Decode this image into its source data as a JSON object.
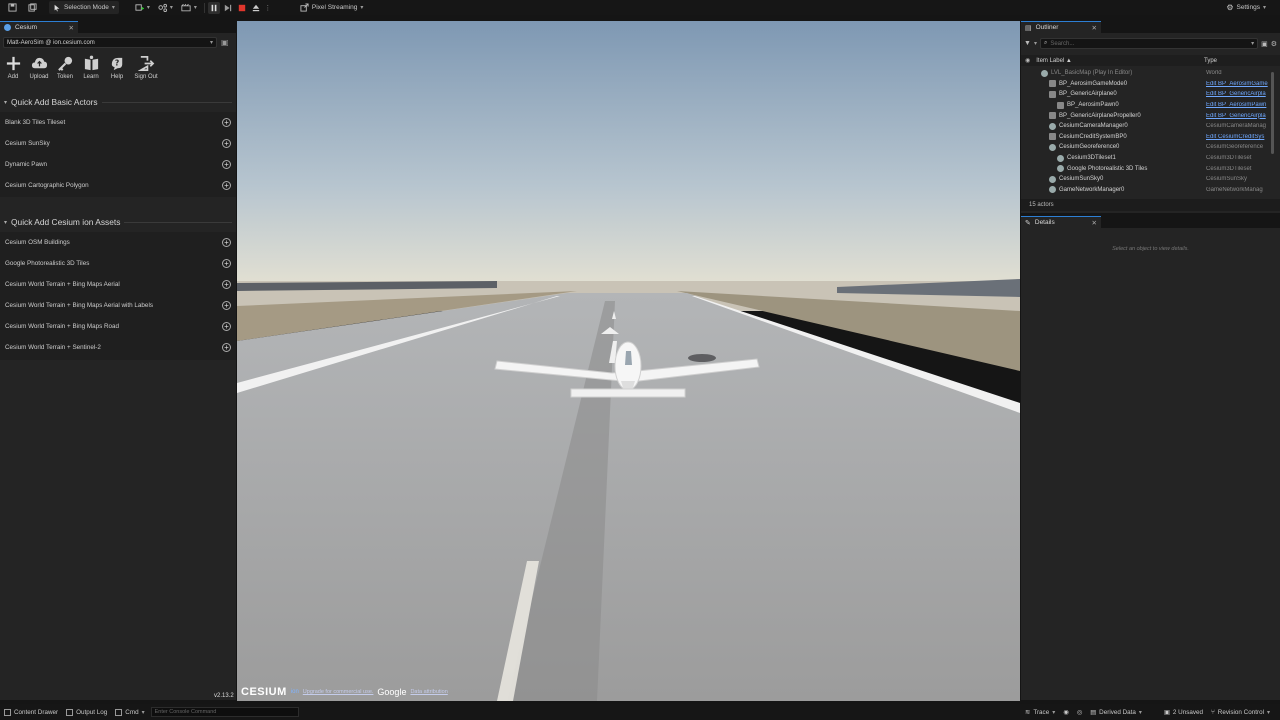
{
  "toolbar": {
    "mode_label": "Selection Mode",
    "streaming_label": "Pixel Streaming",
    "settings_label": "Settings"
  },
  "cesium_panel": {
    "tab_label": "Cesium",
    "account": "Matt-AeroSim @ ion.cesium.com",
    "tools": [
      {
        "label": "Add",
        "icon": "plus-icon"
      },
      {
        "label": "Upload",
        "icon": "cloud-upload-icon"
      },
      {
        "label": "Token",
        "icon": "key-icon"
      },
      {
        "label": "Learn",
        "icon": "book-icon"
      },
      {
        "label": "Help",
        "icon": "help-icon"
      },
      {
        "label": "Sign Out",
        "icon": "sign-out-icon"
      }
    ],
    "basic_header": "Quick Add Basic Actors",
    "basic_actors": [
      "Blank 3D Tiles Tileset",
      "Cesium SunSky",
      "Dynamic Pawn",
      "Cesium Cartographic Polygon"
    ],
    "ion_header": "Quick Add Cesium ion Assets",
    "ion_assets": [
      "Cesium OSM Buildings",
      "Google Photorealistic 3D Tiles",
      "Cesium World Terrain + Bing Maps Aerial",
      "Cesium World Terrain + Bing Maps Aerial with Labels",
      "Cesium World Terrain + Bing Maps Road",
      "Cesium World Terrain + Sentinel-2"
    ],
    "version": "v2.13.2"
  },
  "viewport": {
    "cesium_logo": "CESIUM",
    "ion_word": "ion",
    "upgrade_link": "Upgrade for commercial use.",
    "google_word": "Google",
    "data_attribution": "Data attribution"
  },
  "outliner": {
    "tab_label": "Outliner",
    "search_placeholder": "Search...",
    "col_label": "Item Label ▲",
    "col_type": "Type",
    "rows": [
      {
        "label": "LVL_BasicMap (Play In Editor)",
        "type": "World",
        "indent": 0,
        "dim": true,
        "link": false
      },
      {
        "label": "BP_AerosimGameMode0",
        "type": "Edit BP_AerosimGame",
        "indent": 1,
        "link": true
      },
      {
        "label": "BP_GenericAirplane0",
        "type": "Edit BP_GenericAirpla",
        "indent": 1,
        "link": true
      },
      {
        "label": "BP_AerosimPawn0",
        "type": "Edit BP_AerosimPawn",
        "indent": 2,
        "link": true
      },
      {
        "label": "BP_GenericAirplanePropeller0",
        "type": "Edit BP_GenericAirpla",
        "indent": 1,
        "link": true
      },
      {
        "label": "CesiumCameraManager0",
        "type": "CesiumCameraManag",
        "indent": 1,
        "link": false
      },
      {
        "label": "CesiumCreditSystemBP0",
        "type": "Edit CesiumCreditSys",
        "indent": 1,
        "link": true
      },
      {
        "label": "CesiumGeoreference0",
        "type": "CesiumGeoreference",
        "indent": 1,
        "link": false
      },
      {
        "label": "Cesium3DTileset1",
        "type": "Cesium3DTileset",
        "indent": 2,
        "link": false
      },
      {
        "label": "Google Photorealistic 3D Tiles",
        "type": "Cesium3DTileset",
        "indent": 2,
        "link": false
      },
      {
        "label": "CesiumSunSky0",
        "type": "CesiumSunSky",
        "indent": 1,
        "link": false
      },
      {
        "label": "GameNetworkManager0",
        "type": "GameNetworkManag",
        "indent": 1,
        "link": false
      }
    ],
    "count": "15 actors"
  },
  "details": {
    "tab_label": "Details",
    "hint": "Select an object to view details."
  },
  "statusbar": {
    "content_drawer": "Content Drawer",
    "output_log": "Output Log",
    "cmd": "Cmd",
    "console_placeholder": "Enter Console Command",
    "trace": "Trace",
    "derived_data": "Derived Data",
    "unsaved": "2 Unsaved",
    "revision_control": "Revision Control"
  },
  "colors": {
    "accent": "#2d7fd4",
    "panel": "#242424",
    "background": "#151515",
    "link": "#6fa8ff",
    "stop_red": "#e0362c"
  }
}
